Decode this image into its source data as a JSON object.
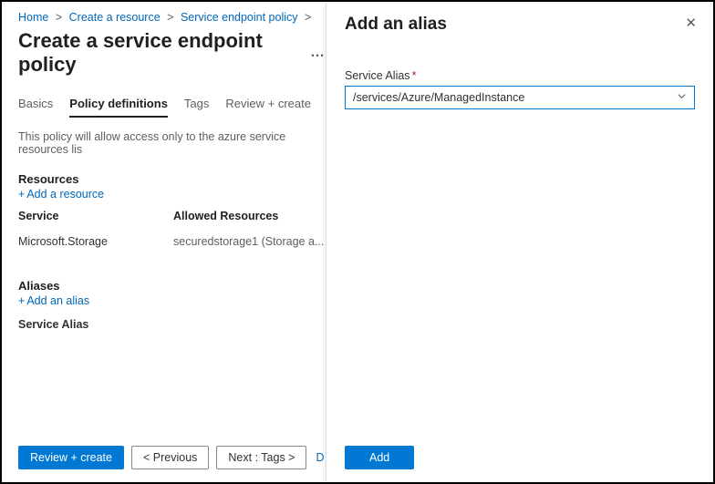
{
  "breadcrumb": {
    "home": "Home",
    "create_resource": "Create a resource",
    "sep": "Service endpoint policy"
  },
  "page": {
    "title": "Create a service endpoint policy",
    "dots": "…"
  },
  "tabs": {
    "basics": "Basics",
    "policy_defs": "Policy definitions",
    "tags": "Tags",
    "review": "Review + create"
  },
  "description": "This policy will allow access only to the azure service resources lis",
  "resources": {
    "heading": "Resources",
    "add": "Add a resource",
    "col_service": "Service",
    "col_allowed": "Allowed Resources",
    "row_service": "Microsoft.Storage",
    "row_allowed": "securedstorage1 (Storage a..."
  },
  "aliases": {
    "heading": "Aliases",
    "add": "Add an alias",
    "col": "Service Alias"
  },
  "footer": {
    "review": "Review + create",
    "prev": "<  Previous",
    "next": "Next : Tags  >",
    "download": "D"
  },
  "panel": {
    "title": "Add an alias",
    "field_label": "Service Alias",
    "value": "/services/Azure/ManagedInstance",
    "add": "Add"
  }
}
